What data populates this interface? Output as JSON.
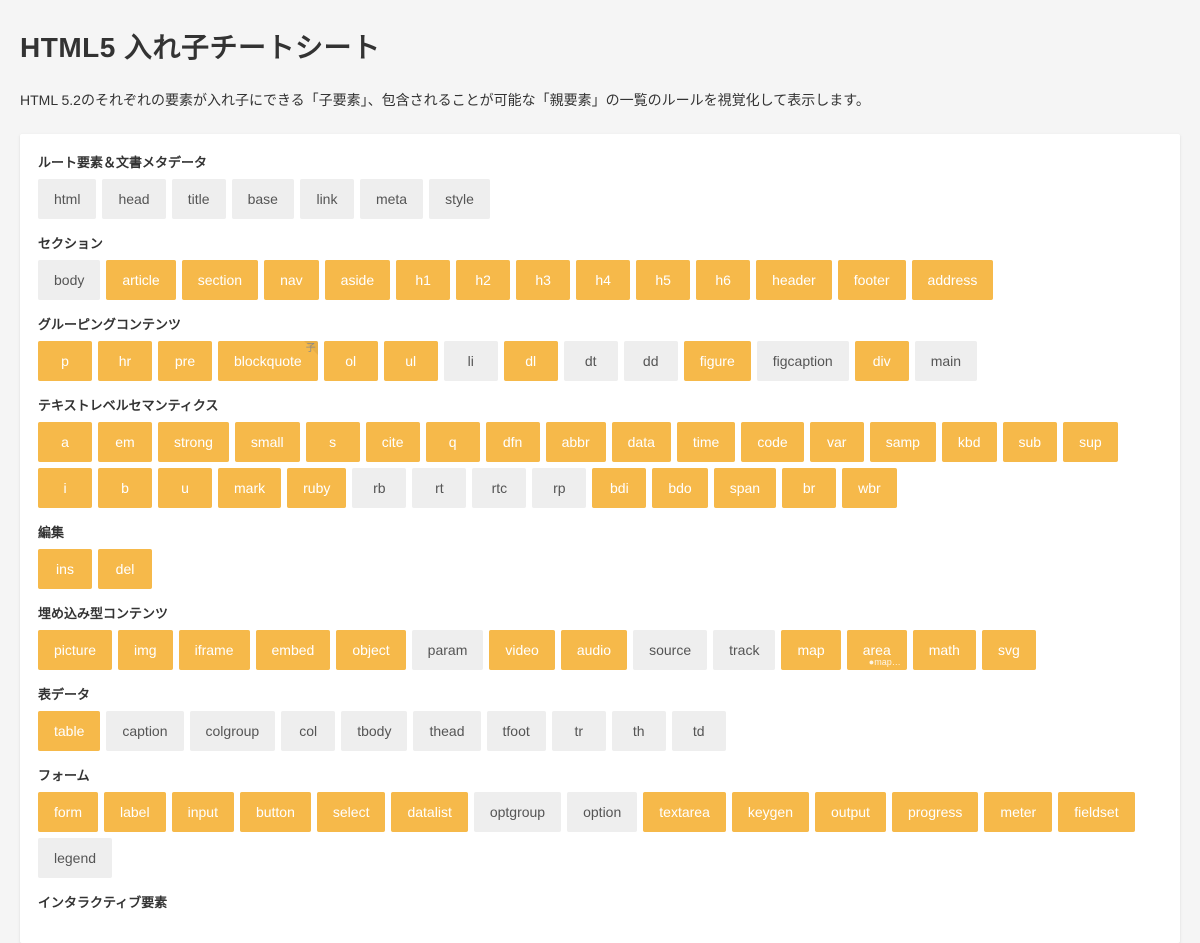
{
  "title": "HTML5 入れ子チートシート",
  "intro": "HTML 5.2のそれぞれの要素が入れ子にできる「子要素」、包含されることが可能な「親要素」の一覧のルールを視覚化して表示します。",
  "sections": [
    {
      "title": "ルート要素＆文書メタデータ",
      "items": [
        {
          "label": "html",
          "style": "gray"
        },
        {
          "label": "head",
          "style": "gray"
        },
        {
          "label": "title",
          "style": "gray"
        },
        {
          "label": "base",
          "style": "gray"
        },
        {
          "label": "link",
          "style": "gray"
        },
        {
          "label": "meta",
          "style": "gray"
        },
        {
          "label": "style",
          "style": "gray"
        }
      ]
    },
    {
      "title": "セクション",
      "items": [
        {
          "label": "body",
          "style": "gray"
        },
        {
          "label": "article",
          "style": "amber"
        },
        {
          "label": "section",
          "style": "amber"
        },
        {
          "label": "nav",
          "style": "amber"
        },
        {
          "label": "aside",
          "style": "amber"
        },
        {
          "label": "h1",
          "style": "amber"
        },
        {
          "label": "h2",
          "style": "amber"
        },
        {
          "label": "h3",
          "style": "amber"
        },
        {
          "label": "h4",
          "style": "amber"
        },
        {
          "label": "h5",
          "style": "amber"
        },
        {
          "label": "h6",
          "style": "amber"
        },
        {
          "label": "header",
          "style": "amber"
        },
        {
          "label": "footer",
          "style": "amber"
        },
        {
          "label": "address",
          "style": "amber"
        }
      ]
    },
    {
      "title": "グルーピングコンテンツ",
      "items": [
        {
          "label": "p",
          "style": "amber"
        },
        {
          "label": "hr",
          "style": "amber"
        },
        {
          "label": "pre",
          "style": "amber"
        },
        {
          "label": "blockquote",
          "style": "amber",
          "corner": "子"
        },
        {
          "label": "ol",
          "style": "amber"
        },
        {
          "label": "ul",
          "style": "amber"
        },
        {
          "label": "li",
          "style": "gray"
        },
        {
          "label": "dl",
          "style": "amber"
        },
        {
          "label": "dt",
          "style": "gray"
        },
        {
          "label": "dd",
          "style": "gray"
        },
        {
          "label": "figure",
          "style": "amber"
        },
        {
          "label": "figcaption",
          "style": "gray"
        },
        {
          "label": "div",
          "style": "amber"
        },
        {
          "label": "main",
          "style": "gray"
        }
      ]
    },
    {
      "title": "テキストレベルセマンティクス",
      "items": [
        {
          "label": "a",
          "style": "amber"
        },
        {
          "label": "em",
          "style": "amber"
        },
        {
          "label": "strong",
          "style": "amber"
        },
        {
          "label": "small",
          "style": "amber"
        },
        {
          "label": "s",
          "style": "amber"
        },
        {
          "label": "cite",
          "style": "amber"
        },
        {
          "label": "q",
          "style": "amber"
        },
        {
          "label": "dfn",
          "style": "amber"
        },
        {
          "label": "abbr",
          "style": "amber"
        },
        {
          "label": "data",
          "style": "amber"
        },
        {
          "label": "time",
          "style": "amber"
        },
        {
          "label": "code",
          "style": "amber"
        },
        {
          "label": "var",
          "style": "amber"
        },
        {
          "label": "samp",
          "style": "amber"
        },
        {
          "label": "kbd",
          "style": "amber"
        },
        {
          "label": "sub",
          "style": "amber"
        },
        {
          "label": "sup",
          "style": "amber"
        },
        {
          "label": "i",
          "style": "amber"
        },
        {
          "label": "b",
          "style": "amber"
        },
        {
          "label": "u",
          "style": "amber"
        },
        {
          "label": "mark",
          "style": "amber"
        },
        {
          "label": "ruby",
          "style": "amber"
        },
        {
          "label": "rb",
          "style": "gray"
        },
        {
          "label": "rt",
          "style": "gray"
        },
        {
          "label": "rtc",
          "style": "gray"
        },
        {
          "label": "rp",
          "style": "gray"
        },
        {
          "label": "bdi",
          "style": "amber"
        },
        {
          "label": "bdo",
          "style": "amber"
        },
        {
          "label": "span",
          "style": "amber"
        },
        {
          "label": "br",
          "style": "amber"
        },
        {
          "label": "wbr",
          "style": "amber"
        }
      ]
    },
    {
      "title": "編集",
      "items": [
        {
          "label": "ins",
          "style": "amber"
        },
        {
          "label": "del",
          "style": "amber"
        }
      ]
    },
    {
      "title": "埋め込み型コンテンツ",
      "items": [
        {
          "label": "picture",
          "style": "amber"
        },
        {
          "label": "img",
          "style": "amber"
        },
        {
          "label": "iframe",
          "style": "amber"
        },
        {
          "label": "embed",
          "style": "amber"
        },
        {
          "label": "object",
          "style": "amber"
        },
        {
          "label": "param",
          "style": "gray"
        },
        {
          "label": "video",
          "style": "amber"
        },
        {
          "label": "audio",
          "style": "amber"
        },
        {
          "label": "source",
          "style": "gray"
        },
        {
          "label": "track",
          "style": "gray"
        },
        {
          "label": "map",
          "style": "amber"
        },
        {
          "label": "area",
          "style": "amber",
          "hint": "●map…"
        },
        {
          "label": "math",
          "style": "amber"
        },
        {
          "label": "svg",
          "style": "amber"
        }
      ]
    },
    {
      "title": "表データ",
      "items": [
        {
          "label": "table",
          "style": "amber"
        },
        {
          "label": "caption",
          "style": "gray"
        },
        {
          "label": "colgroup",
          "style": "gray"
        },
        {
          "label": "col",
          "style": "gray"
        },
        {
          "label": "tbody",
          "style": "gray"
        },
        {
          "label": "thead",
          "style": "gray"
        },
        {
          "label": "tfoot",
          "style": "gray"
        },
        {
          "label": "tr",
          "style": "gray"
        },
        {
          "label": "th",
          "style": "gray"
        },
        {
          "label": "td",
          "style": "gray"
        }
      ]
    },
    {
      "title": "フォーム",
      "items": [
        {
          "label": "form",
          "style": "amber"
        },
        {
          "label": "label",
          "style": "amber"
        },
        {
          "label": "input",
          "style": "amber"
        },
        {
          "label": "button",
          "style": "amber"
        },
        {
          "label": "select",
          "style": "amber"
        },
        {
          "label": "datalist",
          "style": "amber"
        },
        {
          "label": "optgroup",
          "style": "gray"
        },
        {
          "label": "option",
          "style": "gray"
        },
        {
          "label": "textarea",
          "style": "amber"
        },
        {
          "label": "keygen",
          "style": "amber"
        },
        {
          "label": "output",
          "style": "amber"
        },
        {
          "label": "progress",
          "style": "amber"
        },
        {
          "label": "meter",
          "style": "amber"
        },
        {
          "label": "fieldset",
          "style": "amber"
        },
        {
          "label": "legend",
          "style": "gray"
        }
      ]
    },
    {
      "title": "インタラクティブ要素",
      "items": []
    }
  ]
}
